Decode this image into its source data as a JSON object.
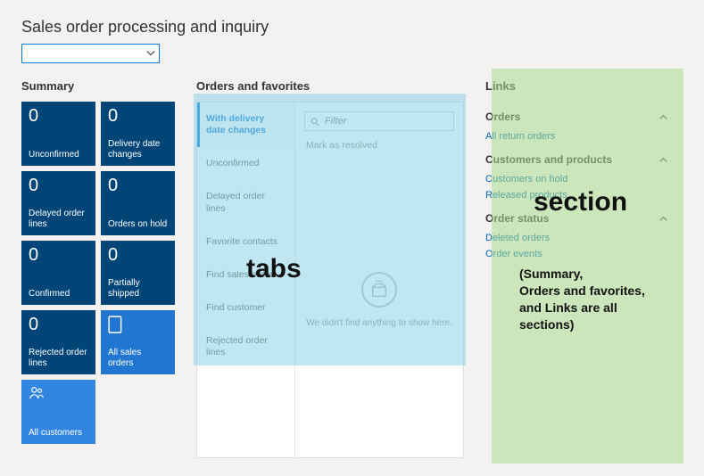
{
  "title": "Sales order processing and inquiry",
  "dropdown": {
    "value": ""
  },
  "summary": {
    "header": "Summary",
    "tiles": [
      {
        "num": "0",
        "label": "Unconfirmed"
      },
      {
        "num": "0",
        "label": "Delivery date changes"
      },
      {
        "num": "0",
        "label": "Delayed order lines"
      },
      {
        "num": "0",
        "label": "Orders on hold"
      },
      {
        "num": "0",
        "label": "Confirmed"
      },
      {
        "num": "0",
        "label": "Partially shipped"
      },
      {
        "num": "0",
        "label": "Rejected order lines"
      },
      {
        "num": "",
        "label": "All sales orders"
      },
      {
        "num": "",
        "label": "All customers"
      }
    ]
  },
  "orders_favorites": {
    "header": "Orders and favorites",
    "tabs": [
      "With delivery date changes",
      "Unconfirmed",
      "Delayed order lines",
      "Favorite contacts",
      "Find sales order",
      "Find customer",
      "Rejected order lines"
    ],
    "filter_placeholder": "Filter",
    "resolve_label": "Mark as resolved",
    "empty_text": "We didn't find anything to show here."
  },
  "links": {
    "header": "Links",
    "groups": [
      {
        "title": "Orders",
        "items": [
          "All return orders"
        ]
      },
      {
        "title": "Customers and products",
        "items": [
          "Customers on hold",
          "Released products"
        ]
      },
      {
        "title": "Order status",
        "items": [
          "Deleted orders",
          "Order events"
        ]
      }
    ]
  },
  "annotations": {
    "tabs_label": "tabs",
    "section_label": "section",
    "section_note": "(Summary,\nOrders and favorites,\nand Links are all\nsections)"
  }
}
